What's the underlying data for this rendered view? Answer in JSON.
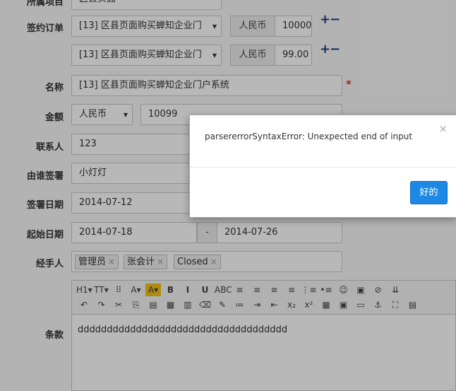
{
  "form": {
    "top_cut_label": "所属项目",
    "top_cut_value": "区县页面",
    "contract_label": "签约订单",
    "orders": [
      {
        "name": "[13] 区县页面购买蝉知企业门",
        "currency": "人民币",
        "amount": "10000"
      },
      {
        "name": "[13] 区县页面购买蝉知企业门",
        "currency": "人民币",
        "amount": "99.00"
      }
    ],
    "plus_minus": "+−",
    "name_label": "名称",
    "name_value": "[13] 区县页面购买蝉知企业门户系统",
    "required_mark": "*",
    "amount_label": "金额",
    "amount_currency": "人民币",
    "amount_value": "10099",
    "contact_label": "联系人",
    "contact_value": "123",
    "signer_label": "由谁签署",
    "signer_value": "小灯灯",
    "sign_date_label": "签署日期",
    "sign_date_value": "2014-07-12",
    "period_label": "起始日期",
    "start_date": "2014-07-18",
    "date_sep": "-",
    "end_date": "2014-07-26",
    "handlers_label": "经手人",
    "handlers": [
      "管理员",
      "张会计",
      "Closed"
    ],
    "tag_remove": "×",
    "terms_label": "条款",
    "terms_value": "dddddddddddddddddddddddddddddddddddd"
  },
  "editor_toolbar": {
    "row1": [
      "H1▾",
      "TT▾",
      "⠿",
      "A▾",
      "A▾",
      "B",
      "I",
      "U",
      "ABC",
      "≡",
      "≡",
      "≡",
      "≡",
      "⋮≡",
      "•≡",
      "☺",
      "▣",
      "⊘",
      "⇊"
    ],
    "row2": [
      "↶",
      "↷",
      "✂",
      "⎘",
      "▤",
      "▦",
      "▥",
      "⌫",
      "✎",
      "≔",
      "⇥",
      "⇤",
      "x₂",
      "x²",
      "▦",
      "▣",
      "▭",
      "⚓",
      "⛶",
      "▤"
    ]
  },
  "modal": {
    "message": "parsererrorSyntaxError: Unexpected end of input",
    "close_glyph": "×",
    "ok_label": "好的"
  },
  "colors": {
    "primary": "#1e88e5",
    "required": "#d9342b",
    "plus_minus": "#1f3f7a"
  }
}
